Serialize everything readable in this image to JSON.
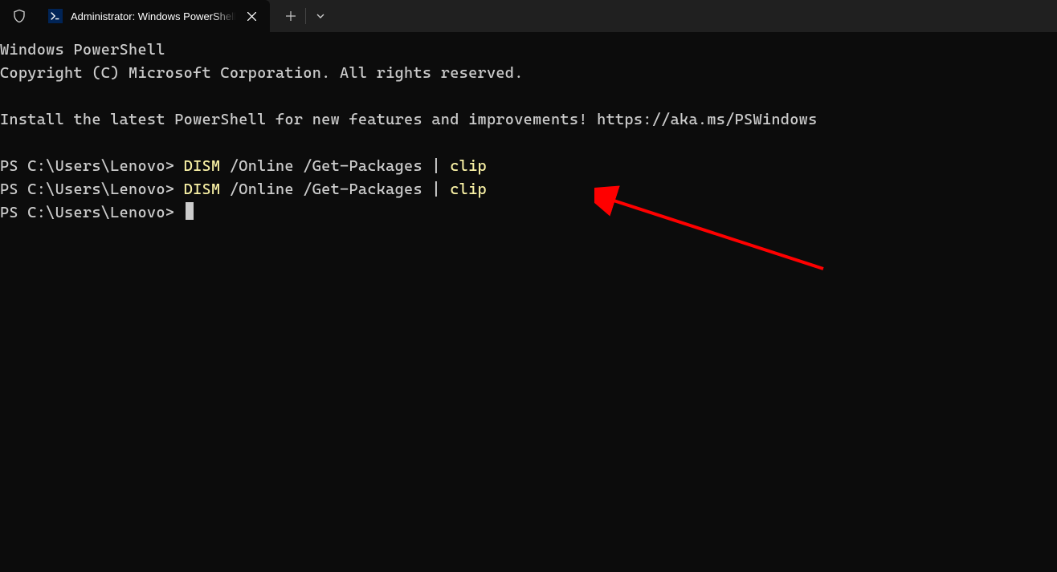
{
  "titlebar": {
    "tab_title": "Administrator: Windows PowerShell",
    "new_tab_label": "+",
    "dropdown_label": "⌄"
  },
  "terminal": {
    "banner_line1": "Windows PowerShell",
    "banner_line2": "Copyright (C) Microsoft Corporation. All rights reserved.",
    "install_msg": "Install the latest PowerShell for new features and improvements! https://aka.ms/PSWindows",
    "prompt": "PS C:\\Users\\Lenovo> ",
    "lines": [
      {
        "prompt": "PS C:\\Users\\Lenovo> ",
        "cmd_part1": "DISM",
        "cmd_part2": " /Online /Get-Packages ",
        "pipe": "|",
        "cmd_part3": " ",
        "cmd_part4": "clip"
      },
      {
        "prompt": "PS C:\\Users\\Lenovo> ",
        "cmd_part1": "DISM",
        "cmd_part2": " /Online /Get-Packages ",
        "pipe": "|",
        "cmd_part3": " ",
        "cmd_part4": "clip"
      },
      {
        "prompt": "PS C:\\Users\\Lenovo> "
      }
    ]
  },
  "annotation": {
    "arrow_color": "#ff0000"
  }
}
